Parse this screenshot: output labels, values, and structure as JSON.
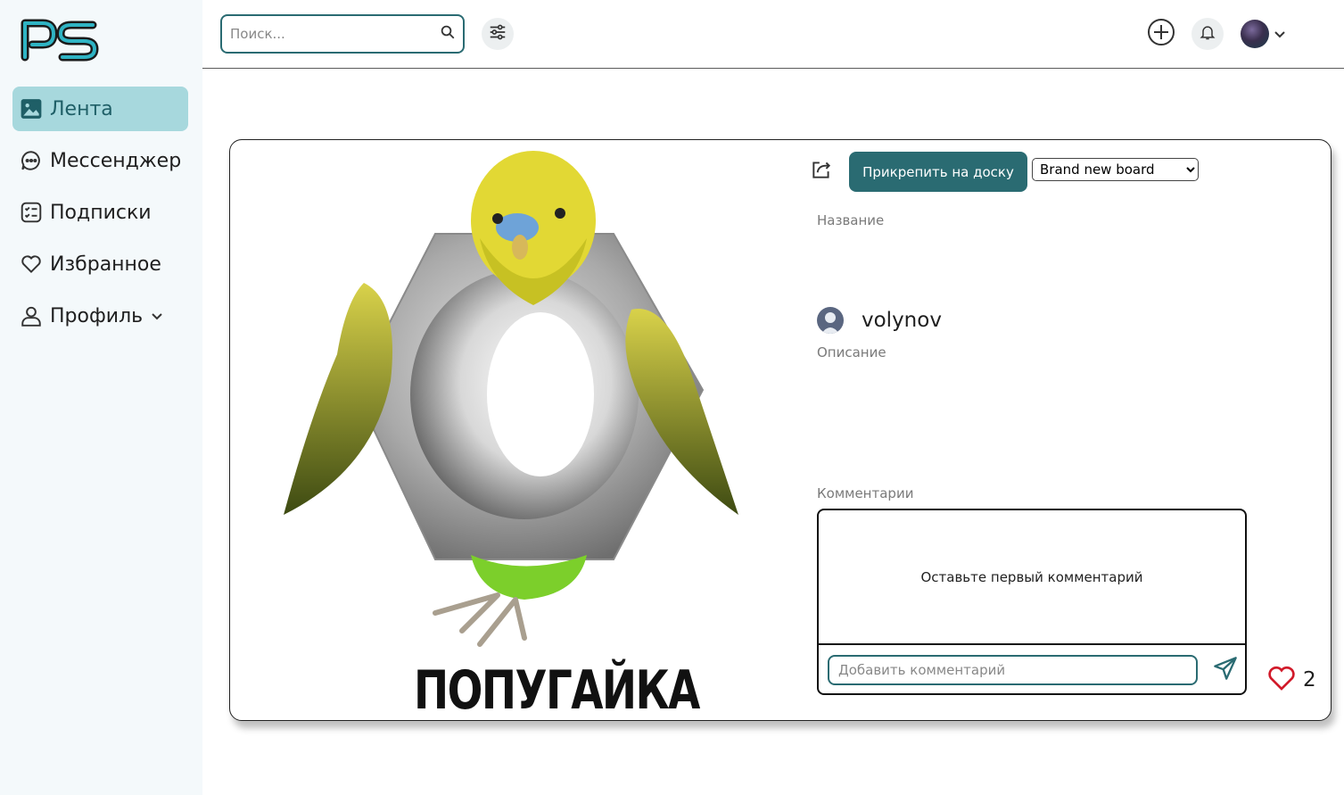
{
  "colors": {
    "accent": "#2a6b72",
    "active_nav_bg": "#a7d8dd",
    "sidebar_bg": "#f4f9fb",
    "like": "#d11a2a"
  },
  "logo": {
    "text": "PS"
  },
  "sidebar": {
    "items": [
      {
        "label": "Лента",
        "icon": "image-icon",
        "active": true
      },
      {
        "label": "Мессенджер",
        "icon": "chat-bubble-icon",
        "active": false
      },
      {
        "label": "Подписки",
        "icon": "checklist-icon",
        "active": false
      },
      {
        "label": "Избранное",
        "icon": "heart-icon",
        "active": false
      },
      {
        "label": "Профиль",
        "icon": "user-icon",
        "active": false,
        "has_dropdown": true
      }
    ]
  },
  "header": {
    "search": {
      "placeholder": "Поиск..."
    }
  },
  "pin": {
    "image_caption": "ПОПУГАЙКА",
    "pin_button_label": "Прикрепить на доску",
    "board_select": {
      "selected": "Brand new board",
      "options": [
        "Brand new board"
      ]
    },
    "title_label": "Название",
    "author_name": "volynov",
    "description_label": "Описание",
    "comments_label": "Комментарии",
    "comments_empty_text": "Оставьте первый комментарий",
    "comment_input_placeholder": "Добавить комментарий",
    "likes_count": "2"
  }
}
